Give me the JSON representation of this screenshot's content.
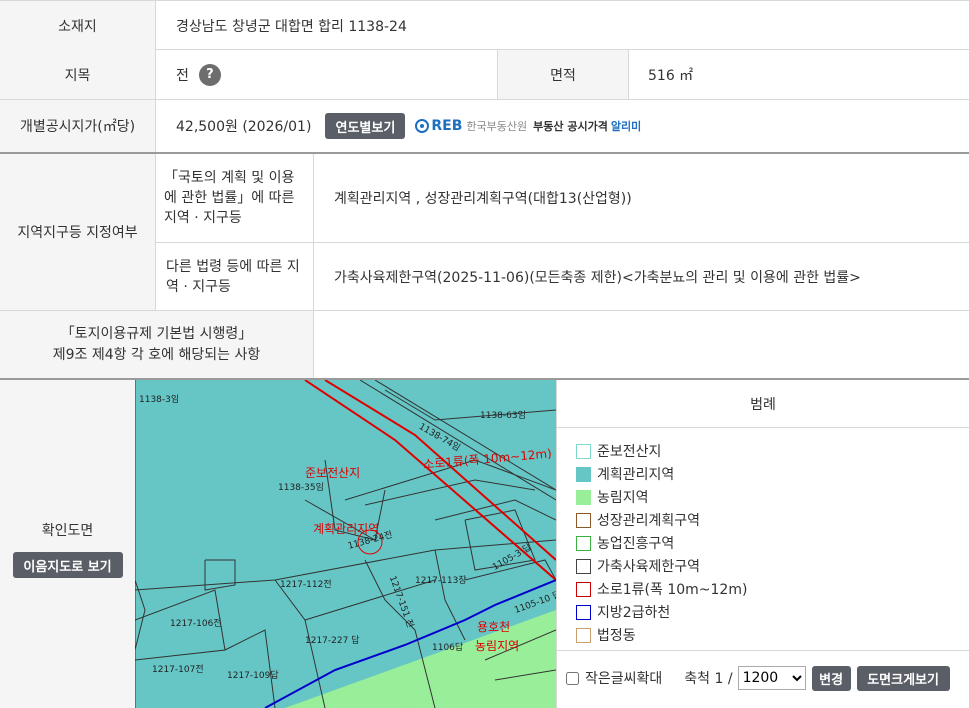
{
  "location": {
    "label": "소재지",
    "value": "경상남도 창녕군 대합면 합리 1138-24"
  },
  "land_category": {
    "label": "지목",
    "value": "전",
    "help": "?"
  },
  "area": {
    "label": "면적",
    "value": "516 ㎡"
  },
  "official_price": {
    "label": "개별공시지가(㎡당)",
    "value": "42,500원 (2026/01)",
    "button": "연도별보기",
    "reb_logo": "REB",
    "reb_org": "한국부동산원",
    "reb_service": "부동산 공시가격",
    "reb_service_highlight": "알리미"
  },
  "zoning": {
    "label": "지역지구등 지정여부",
    "sub1_label": "「국토의 계획 및 이용에 관한 법률」에 따른 지역 · 지구등",
    "sub1_value": "계획관리지역 , 성장관리계획구역(대합13(산업형))",
    "sub2_label": "다른 법령 등에 따른 지역 · 지구등",
    "sub2_value": "가축사육제한구역(2025-11-06)(모든축종 제한)<가축분뇨의 관리 및 이용에 관한 법률>"
  },
  "regulation": {
    "label_line1": "「토지이용규제 기본법 시행령」",
    "label_line2": "제9조 제4항 각 호에 해당되는 사항",
    "value": ""
  },
  "map_section": {
    "label": "확인도면",
    "button": "이음지도로 보기",
    "legend_title": "범례",
    "legend": [
      {
        "name": "준보전산지",
        "color": "#7fd8c8",
        "fill": "#ffffff"
      },
      {
        "name": "계획관리지역",
        "color": "#66c6c6",
        "fill": "#66c6c6"
      },
      {
        "name": "농림지역",
        "color": "#99ee99",
        "fill": "#99ee99"
      },
      {
        "name": "성장관리계획구역",
        "color": "#8b5a2b",
        "fill": "#ffffff"
      },
      {
        "name": "농업진흥구역",
        "color": "#3cb043",
        "fill": "#ffffff"
      },
      {
        "name": "가축사육제한구역",
        "color": "#444444",
        "fill": "#ffffff"
      },
      {
        "name": "소로1류(폭 10m~12m)",
        "color": "#cc0000",
        "fill": "#ffffff"
      },
      {
        "name": "지방2급하천",
        "color": "#0000cc",
        "fill": "#ffffff"
      },
      {
        "name": "법정동",
        "color": "#c8a070",
        "fill": "#ffffff"
      }
    ],
    "small_text_label": "작은글씨확대",
    "scale_label": "축척 1 /",
    "scale_value": "1200",
    "scale_options": [
      "1200"
    ],
    "change_button": "변경",
    "enlarge_button": "도면크게보기",
    "map_labels": {
      "l1": "1138-3임",
      "l2": "1138-63임",
      "l3": "1138-74임",
      "l4": "1138-35임",
      "l5": "1217-112전",
      "l6": "1217-113장",
      "l7": "1217-106전",
      "l8": "1217-227 답",
      "l9": "1106답",
      "l10": "1217-107전",
      "l11": "1217-109답",
      "l12": "1105-10 답",
      "l13": "1138-24전",
      "l14": "1105-3 답",
      "l15": "1217-151 전",
      "r1": "준보전산지",
      "r2": "계획관리지역",
      "r3": "소로1류(폭 10m~12m)",
      "r4": "용호천",
      "r5": "농림지역"
    }
  }
}
